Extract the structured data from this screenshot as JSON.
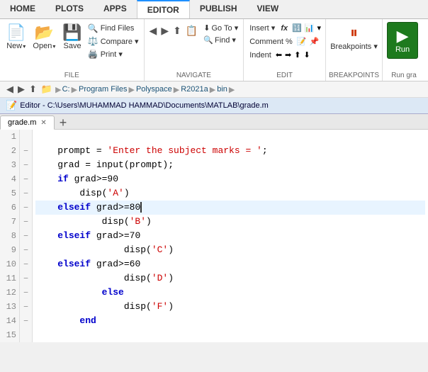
{
  "menubar": {
    "items": [
      {
        "label": "HOME",
        "active": false
      },
      {
        "label": "PLOTS",
        "active": false
      },
      {
        "label": "APPS",
        "active": false
      },
      {
        "label": "EDITOR",
        "active": true
      },
      {
        "label": "PUBLISH",
        "active": false
      },
      {
        "label": "VIEW",
        "active": false
      }
    ]
  },
  "ribbon": {
    "groups": [
      {
        "label": "FILE",
        "buttons_large": [
          {
            "icon": "📄",
            "label": "New",
            "has_dropdown": true
          },
          {
            "icon": "📂",
            "label": "Open",
            "has_dropdown": true
          },
          {
            "icon": "💾",
            "label": "Save",
            "has_dropdown": false
          }
        ],
        "buttons_small": [
          {
            "icon": "🔍",
            "label": "Find Files"
          },
          {
            "icon": "⚖️",
            "label": "Compare ▾"
          },
          {
            "icon": "🖨️",
            "label": "Print ▾"
          }
        ]
      },
      {
        "label": "NAVIGATE",
        "buttons_small": [
          {
            "icon": "◀",
            "label": ""
          },
          {
            "icon": "▶",
            "label": ""
          },
          {
            "icon": "⬆",
            "label": ""
          },
          {
            "icon": "📋",
            "label": ""
          },
          {
            "icon": "⬇",
            "label": "Go To ▾"
          },
          {
            "icon": "🔍",
            "label": "Find ▾"
          }
        ]
      },
      {
        "label": "EDIT",
        "items": [
          {
            "label": "Insert ▾",
            "row": 1
          },
          {
            "label": "fx",
            "row": 1
          },
          {
            "label": "Comment %",
            "row": 2
          },
          {
            "label": "Indent",
            "row": 3
          }
        ]
      },
      {
        "label": "BREAKPOINTS",
        "items": [
          {
            "label": "Breakpoints ▾"
          }
        ]
      },
      {
        "label": "Run gra",
        "run_label": "Run",
        "has_dropdown": true
      }
    ]
  },
  "breadcrumb": {
    "path": [
      "C:",
      "Program Files",
      "Polyspace",
      "R2021a",
      "bin"
    ]
  },
  "editor_title": "Editor - C:\\Users\\MUHAMMAD HAMMAD\\Documents\\MATLAB\\grade.m",
  "tabs": [
    {
      "label": "grade.m",
      "active": true,
      "closeable": true
    },
    {
      "label": "+",
      "is_add": true
    }
  ],
  "code": {
    "lines": [
      {
        "num": 1,
        "dash": "",
        "content": ""
      },
      {
        "num": 2,
        "dash": "–",
        "content": "    prompt = 'Enter the subject marks = ';"
      },
      {
        "num": 3,
        "dash": "–",
        "content": "    grad = input(prompt);"
      },
      {
        "num": 4,
        "dash": "–",
        "content": "    if grad>=90"
      },
      {
        "num": 5,
        "dash": "–",
        "content": "        disp('A')"
      },
      {
        "num": 6,
        "dash": "–",
        "content": "    elseif grad>=80"
      },
      {
        "num": 7,
        "dash": "–",
        "content": "            disp('B')"
      },
      {
        "num": 8,
        "dash": "–",
        "content": "    elseif grad>=70"
      },
      {
        "num": 9,
        "dash": "–",
        "content": "                disp('C')"
      },
      {
        "num": 10,
        "dash": "–",
        "content": "    elseif grad>=60"
      },
      {
        "num": 11,
        "dash": "–",
        "content": "                disp('D')"
      },
      {
        "num": 12,
        "dash": "–",
        "content": "            else"
      },
      {
        "num": 13,
        "dash": "–",
        "content": "                disp('F')"
      },
      {
        "num": 14,
        "dash": "–",
        "content": "        end"
      },
      {
        "num": 15,
        "dash": "",
        "content": ""
      }
    ]
  },
  "colors": {
    "accent_blue": "#1e90ff",
    "run_green": "#1e7a1e",
    "active_tab_bg": "#ffffff",
    "editor_bg": "#ffffff",
    "keyword_color": "#0000cc",
    "string_color": "#cc0000"
  }
}
